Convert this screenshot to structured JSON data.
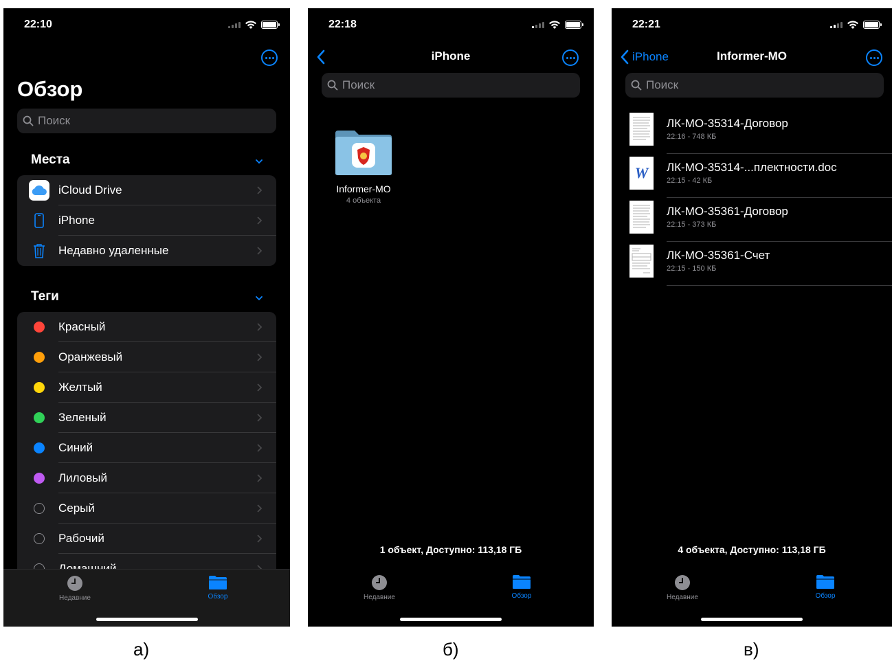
{
  "screens": {
    "a": {
      "time": "22:10",
      "title": "Обзор",
      "search_placeholder": "Поиск",
      "places_header": "Места",
      "places": [
        {
          "label": "iCloud Drive",
          "icon": "icloud-icon"
        },
        {
          "label": "iPhone",
          "icon": "iphone-icon"
        },
        {
          "label": "Недавно удаленные",
          "icon": "trash-icon"
        }
      ],
      "tags_header": "Теги",
      "tags": [
        {
          "label": "Красный",
          "color": "#ff453a"
        },
        {
          "label": "Оранжевый",
          "color": "#ff9f0a"
        },
        {
          "label": "Желтый",
          "color": "#ffd60a"
        },
        {
          "label": "Зеленый",
          "color": "#30d158"
        },
        {
          "label": "Синий",
          "color": "#0a84ff"
        },
        {
          "label": "Лиловый",
          "color": "#bf5af2"
        },
        {
          "label": "Серый",
          "color": ""
        },
        {
          "label": "Рабочий",
          "color": ""
        },
        {
          "label": "Домашний",
          "color": ""
        }
      ],
      "tab_recent": "Недавние",
      "tab_browse": "Обзор"
    },
    "b": {
      "time": "22:18",
      "nav_title": "iPhone",
      "search_placeholder": "Поиск",
      "folder_name": "Informer-MO",
      "folder_count": "4 объекта",
      "footer": "1 объект, Доступно: 113,18 ГБ",
      "tab_recent": "Недавние",
      "tab_browse": "Обзор"
    },
    "c": {
      "time": "22:21",
      "back_label": "iPhone",
      "nav_title": "Informer-MO",
      "search_placeholder": "Поиск",
      "files": [
        {
          "name": "ЛК-МО-35314-Договор",
          "meta": "22:16 - 748 КБ",
          "icon": "document-thumbnail"
        },
        {
          "name": "ЛК-МО-35314-...плектности.doc",
          "meta": "22:15 - 42 КБ",
          "icon": "word-icon"
        },
        {
          "name": "ЛК-МО-35361-Договор",
          "meta": "22:15 - 373 КБ",
          "icon": "document-thumbnail"
        },
        {
          "name": "ЛК-МО-35361-Счет",
          "meta": "22:15 - 150 КБ",
          "icon": "document-thumbnail"
        }
      ],
      "footer": "4 объекта, Доступно: 113,18 ГБ",
      "tab_recent": "Недавние",
      "tab_browse": "Обзор"
    }
  },
  "captions": [
    "а)",
    "б)",
    "в)"
  ],
  "colors": {
    "accent": "#0a84ff",
    "background": "#000000",
    "cell": "#1c1c1e",
    "secondary_text": "#8e8e93"
  }
}
